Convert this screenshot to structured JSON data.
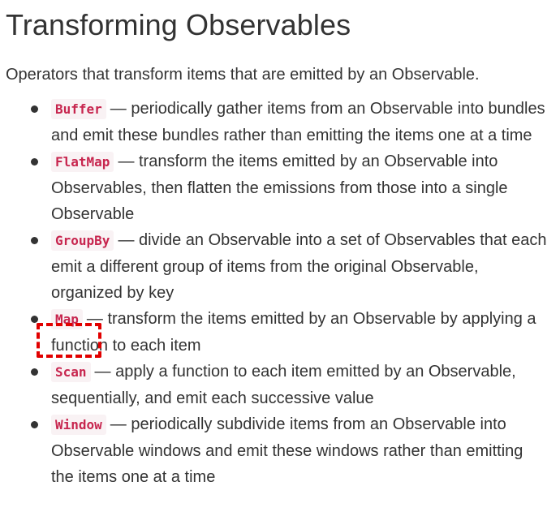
{
  "title": "Transforming Observables",
  "intro": "Operators that transform items that are emitted by an Observable.",
  "operators": [
    {
      "name": "Buffer",
      "description": "— periodically gather items from an Observable into bundles and emit these bundles rather than emitting the items one at a time"
    },
    {
      "name": "FlatMap",
      "description": "— transform the items emitted by an Observable into Observables, then flatten the emissions from those into a single Observable"
    },
    {
      "name": "GroupBy",
      "description": "— divide an Observable into a set of Observables that each emit a different group of items from the original Observable, organized by key"
    },
    {
      "name": "Map",
      "description": "— transform the items emitted by an Observable by applying a function to each item"
    },
    {
      "name": "Scan",
      "description": "— apply a function to each item emitted by an Observable, sequentially, and emit each successive value"
    },
    {
      "name": "Window",
      "description": "— periodically subdivide items from an Observable into Observable windows and emit these windows rather than emitting the items one at a time"
    }
  ],
  "colors": {
    "code_text": "#c7254e",
    "code_background": "#f9f2f4",
    "highlight": "#e10000",
    "text": "#333333"
  }
}
